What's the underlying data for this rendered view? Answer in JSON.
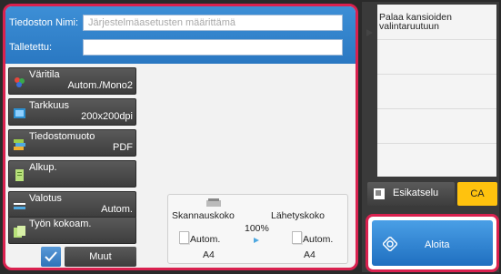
{
  "fields": {
    "filename_label": "Tiedoston Nimi:",
    "filename_placeholder": "Järjestelmäasetusten määrittämä",
    "saved_label": "Talletettu:"
  },
  "buttons": [
    {
      "label": "Väritila",
      "value": "Autom./Mono2",
      "icon": "color-mode-icon"
    },
    {
      "label": "Tarkkuus",
      "value": "200x200dpi",
      "icon": "resolution-icon"
    },
    {
      "label": "Tiedostomuoto",
      "value": "PDF",
      "icon": "file-format-icon"
    },
    {
      "label": "Alkup.",
      "value": "",
      "icon": "original-icon"
    },
    {
      "label": "Valotus",
      "value": "Autom.",
      "icon": "exposure-icon"
    },
    {
      "label": "Työn kokoam.",
      "value": "",
      "icon": "job-build-icon"
    }
  ],
  "more_button": "Muut",
  "scan_info": {
    "scan_size_label": "Skannauskoko",
    "send_size_label": "Lähetyskoko",
    "ratio": "100%",
    "scan_auto": "Autom.",
    "send_auto": "Autom.",
    "scan_paper": "A4",
    "send_paper": "A4"
  },
  "right": {
    "back_label": "Palaa kansioiden valintaruutuun",
    "preview_label": "Esikatselu",
    "ca_label": "CA",
    "start_label": "Aloita"
  }
}
